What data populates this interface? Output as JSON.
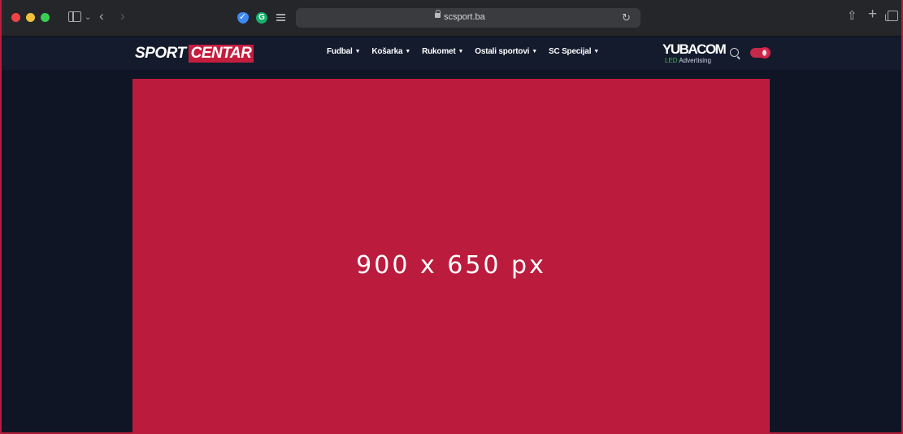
{
  "browser": {
    "url": "scsport.ba",
    "extensions": [
      "shield-extension",
      "grammarly-extension",
      "reader-extension"
    ]
  },
  "site": {
    "logo": {
      "part1": "SPORT",
      "part2": "CENTAR"
    },
    "nav": [
      {
        "label": "Fudbal"
      },
      {
        "label": "Košarka"
      },
      {
        "label": "Rukomet"
      },
      {
        "label": "Ostali sportovi"
      },
      {
        "label": "SC Specijal"
      }
    ],
    "sponsor": {
      "brand": "YUBACOM",
      "tagline_prefix": "LED",
      "tagline_rest": "Advertising"
    }
  },
  "ad": {
    "text": "900 x 650 px"
  },
  "colors": {
    "page_bg": "#0f1525",
    "nav_bg": "#141b2d",
    "accent": "#bb1c3e",
    "browser_chrome": "#25262a"
  }
}
